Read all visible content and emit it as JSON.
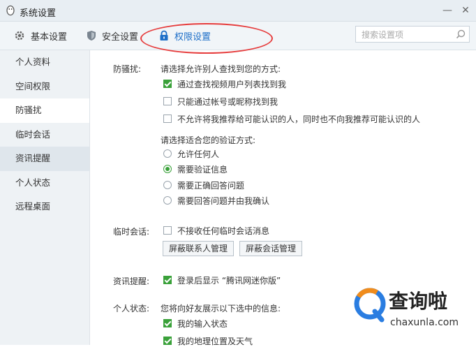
{
  "window": {
    "title": "系统设置",
    "minimize": "—",
    "close": "✕"
  },
  "toolbar": {
    "tabs": [
      {
        "label": "基本设置",
        "icon": "gear-icon"
      },
      {
        "label": "安全设置",
        "icon": "shield-icon"
      },
      {
        "label": "权限设置",
        "icon": "lock-icon",
        "active": true
      }
    ],
    "search_placeholder": "搜索设置项"
  },
  "sidebar": {
    "items": [
      {
        "label": "个人资料"
      },
      {
        "label": "空间权限"
      },
      {
        "label": "防骚扰",
        "active": true
      },
      {
        "label": "临时会话"
      },
      {
        "label": "资讯提醒",
        "hover": true
      },
      {
        "label": "个人状态"
      },
      {
        "label": "远程桌面"
      }
    ]
  },
  "anti_harass": {
    "label": "防骚扰:",
    "find_title": "请选择允许别人查找到您的方式:",
    "find_options": [
      {
        "label": "通过查找视频用户列表找到我",
        "checked": true
      },
      {
        "label": "只能通过帐号或昵称找到我",
        "checked": false
      },
      {
        "label": "不允许将我推荐给可能认识的人，同时也不向我推荐可能认识的人",
        "checked": false
      }
    ],
    "verify_title": "请选择适合您的验证方式:",
    "verify_options": [
      {
        "label": "允许任何人",
        "selected": false
      },
      {
        "label": "需要验证信息",
        "selected": true
      },
      {
        "label": "需要正确回答问题",
        "selected": false
      },
      {
        "label": "需要回答问题并由我确认",
        "selected": false
      }
    ]
  },
  "temp_session": {
    "label": "临时会话:",
    "option": {
      "label": "不接收任何临时会话消息",
      "checked": false
    },
    "buttons": [
      "屏蔽联系人管理",
      "屏蔽会话管理"
    ]
  },
  "news": {
    "label": "资讯提醒:",
    "option": {
      "label": "登录后显示 “腾讯网迷你版”",
      "checked": true
    }
  },
  "status": {
    "label": "个人状态:",
    "title": "您将向好友展示以下选中的信息:",
    "options": [
      {
        "label": "我的输入状态",
        "checked": true
      },
      {
        "label": "我的地理位置及天气",
        "checked": true
      }
    ]
  },
  "watermark": {
    "name": "查询啦",
    "url": "chaxunla.com"
  },
  "colors": {
    "accent": "#1e6fc8",
    "check": "#3aa13a",
    "highlight_circle": "#e63c3c"
  }
}
